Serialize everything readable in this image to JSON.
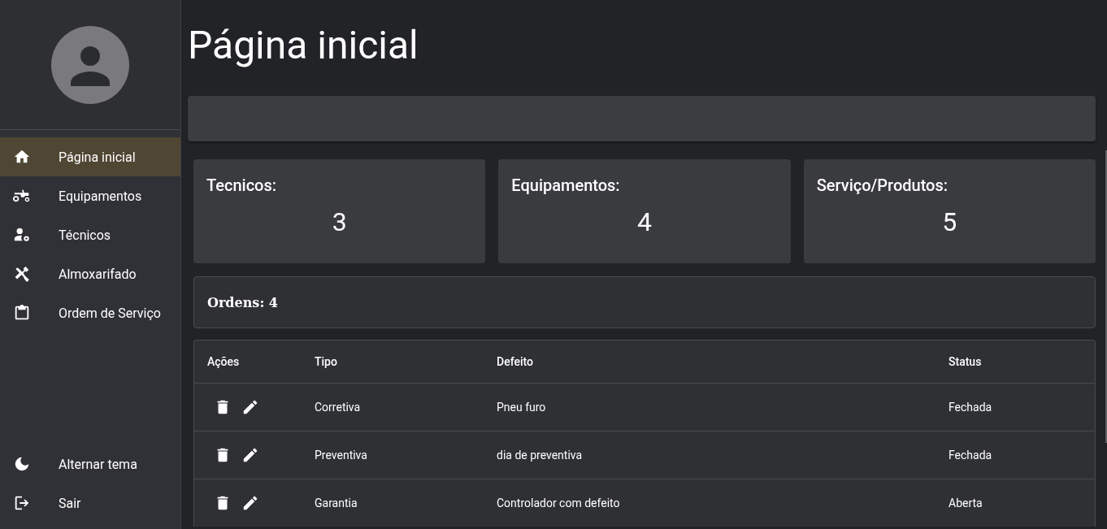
{
  "sidebar": {
    "nav": [
      {
        "label": "Página inicial",
        "kind": "home",
        "selected": true
      },
      {
        "label": "Equipamentos",
        "kind": "tractor",
        "selected": false
      },
      {
        "label": "Técnicos",
        "kind": "user-gear",
        "selected": false
      },
      {
        "label": "Almoxarifado",
        "kind": "tools",
        "selected": false
      },
      {
        "label": "Ordem de Serviço",
        "kind": "clipboard",
        "selected": false
      }
    ],
    "footer": [
      {
        "label": "Alternar tema",
        "kind": "theme"
      },
      {
        "label": "Sair",
        "kind": "logout"
      }
    ]
  },
  "page": {
    "title": "Página inicial"
  },
  "stats": [
    {
      "label": "Tecnicos:",
      "value": "3"
    },
    {
      "label": "Equipamentos:",
      "value": "4"
    },
    {
      "label": "Serviço/Produtos:",
      "value": "5"
    }
  ],
  "orders_summary": "Ordens: 4",
  "table": {
    "columns": [
      "Ações",
      "Tipo",
      "Defeito",
      "Status"
    ],
    "rows": [
      {
        "tipo": "Corretiva",
        "defeito": "Pneu furo",
        "status": "Fechada"
      },
      {
        "tipo": "Preventiva",
        "defeito": "dia de preventiva",
        "status": "Fechada"
      },
      {
        "tipo": "Garantia",
        "defeito": "Controlador com defeito",
        "status": "Aberta"
      }
    ]
  }
}
